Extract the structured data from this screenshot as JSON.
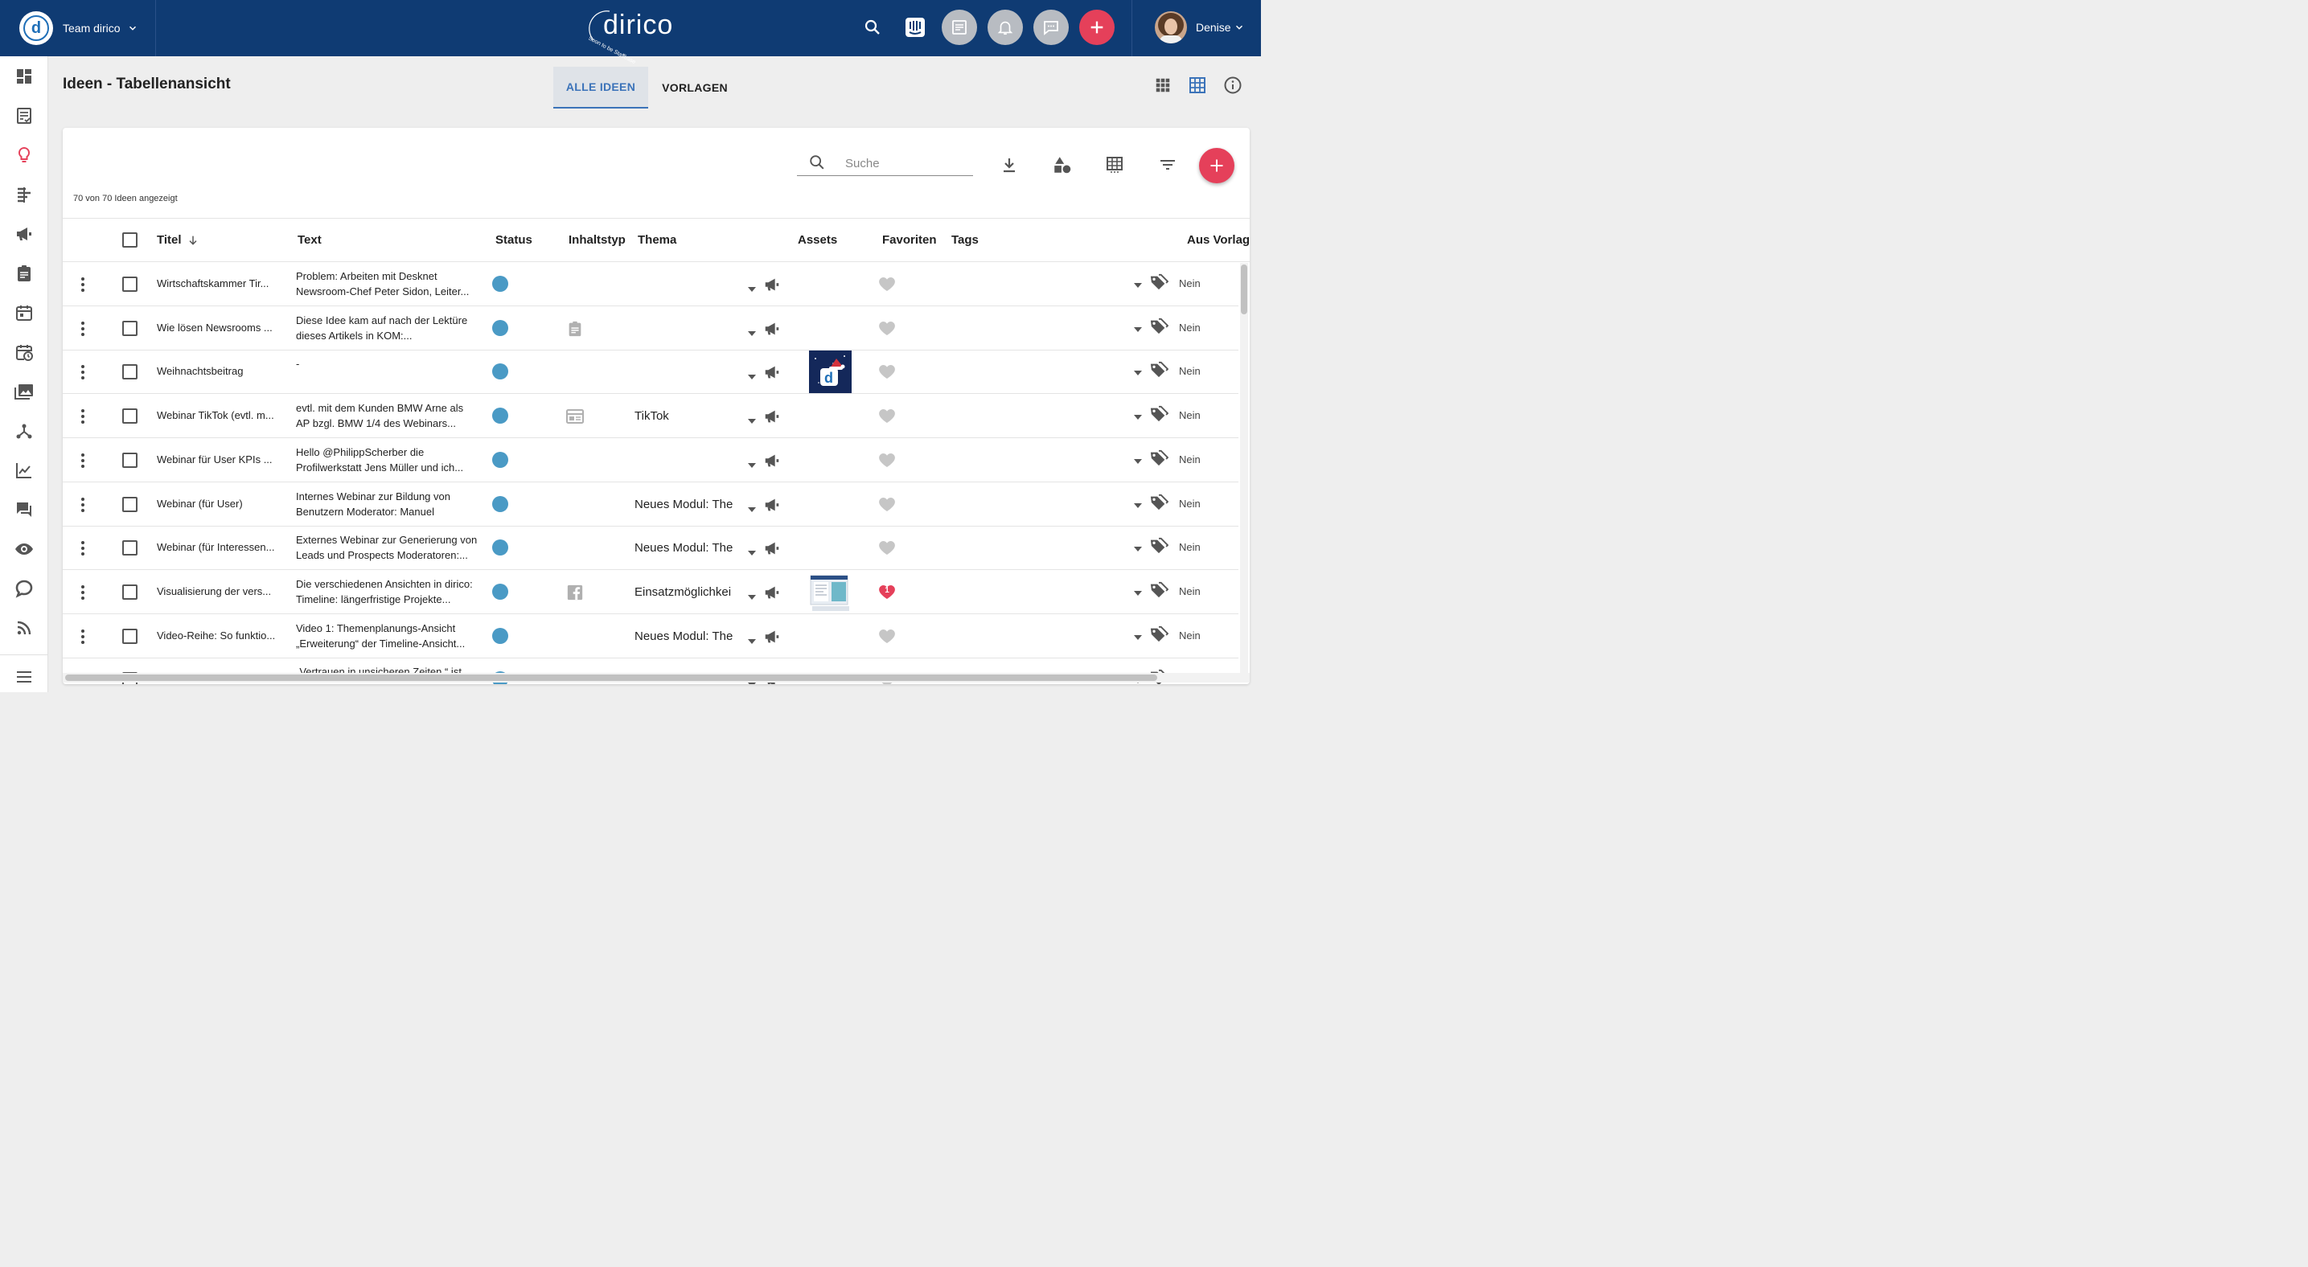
{
  "header": {
    "team_name": "Team dirico",
    "brand_word": "dirico",
    "brand_sub": "Soon to be Staffbase",
    "user_name": "Denise",
    "icons": [
      "search-icon",
      "intercom-icon",
      "article-icon",
      "bell-icon",
      "chat-icon",
      "add-icon"
    ]
  },
  "page": {
    "title": "Ideen - Tabellenansicht",
    "tabs": [
      {
        "label": "ALLE IDEEN",
        "active": true
      },
      {
        "label": "VORLAGEN",
        "active": false
      }
    ]
  },
  "toolbar": {
    "search_placeholder": "Suche",
    "count_text": "70 von 70 Ideen angezeigt"
  },
  "table": {
    "columns": {
      "title": "Titel",
      "text": "Text",
      "status": "Status",
      "type": "Inhaltstyp",
      "topic": "Thema",
      "assets": "Assets",
      "favorites": "Favoriten",
      "tags": "Tags",
      "template": "Aus Vorlage"
    },
    "rows": [
      {
        "title": "Wirtschaftskammer Tir...",
        "text1": "Problem: Arbeiten mit Desknet",
        "text2": "Newsroom-Chef Peter Sidon, Leiter...",
        "type_icon": "",
        "topic": "",
        "asset": "",
        "favorite": false,
        "fav_count": "",
        "template": "Nein"
      },
      {
        "title": "Wie lösen Newsrooms ...",
        "text1": "Diese Idee kam auf nach der Lektüre",
        "text2": "dieses Artikels in KOM:...",
        "type_icon": "clipboard-icon",
        "topic": "",
        "asset": "",
        "favorite": false,
        "fav_count": "",
        "template": "Nein"
      },
      {
        "title": "Weihnachtsbeitrag",
        "text1": "-",
        "text2": "",
        "type_icon": "",
        "topic": "",
        "asset": "xmas",
        "favorite": false,
        "fav_count": "",
        "template": "Nein"
      },
      {
        "title": "Webinar TikTok (evtl. m...",
        "text1": "evtl. mit dem Kunden BMW Arne als",
        "text2": "AP bzgl. BMW 1/4 des Webinars...",
        "type_icon": "web-icon",
        "topic": "TikTok",
        "asset": "",
        "favorite": false,
        "fav_count": "",
        "template": "Nein"
      },
      {
        "title": "Webinar für User KPIs ...",
        "text1": "Hello @PhilippScherber  die",
        "text2": "Profilwerkstatt Jens Müller und ich...",
        "type_icon": "",
        "topic": "",
        "asset": "",
        "favorite": false,
        "fav_count": "",
        "template": "Nein"
      },
      {
        "title": "Webinar (für User)",
        "text1": "Internes Webinar zur Bildung von",
        "text2": "Benutzern  Moderator: Manuel",
        "type_icon": "",
        "topic": "Neues Modul: The",
        "asset": "",
        "favorite": false,
        "fav_count": "",
        "template": "Nein"
      },
      {
        "title": "Webinar (für Interessen...",
        "text1": "Externes Webinar zur Generierung von",
        "text2": "Leads und Prospects  Moderatoren:...",
        "type_icon": "",
        "topic": "Neues Modul: The",
        "asset": "",
        "favorite": false,
        "fav_count": "",
        "template": "Nein"
      },
      {
        "title": "Visualisierung der vers...",
        "text1": "Die verschiedenen Ansichten in dirico:",
        "text2": "Timeline: längerfristige Projekte...",
        "type_icon": "facebook-icon",
        "topic": "Einsatzmöglichkei",
        "asset": "screens",
        "favorite": true,
        "fav_count": "1",
        "template": "Nein"
      },
      {
        "title": "Video-Reihe: So funktio...",
        "text1": "Video 1: Themenplanungs-Ansicht",
        "text2": "„Erweiterung“ der Timeline-Ansicht...",
        "type_icon": "",
        "topic": "Neues Modul: The",
        "asset": "",
        "favorite": false,
        "fav_count": "",
        "template": "Nein"
      },
      {
        "title": "",
        "text1": "„Vertrauen in unsicheren Zeiten.“ ist",
        "text2": "",
        "type_icon": "",
        "topic": "",
        "asset": "",
        "favorite": false,
        "fav_count": "",
        "template": ""
      }
    ]
  },
  "colors": {
    "topbar": "#0f3b73",
    "accent": "#e5405a",
    "status": "#4a9ac5",
    "tab_active": "#3b73b9"
  }
}
